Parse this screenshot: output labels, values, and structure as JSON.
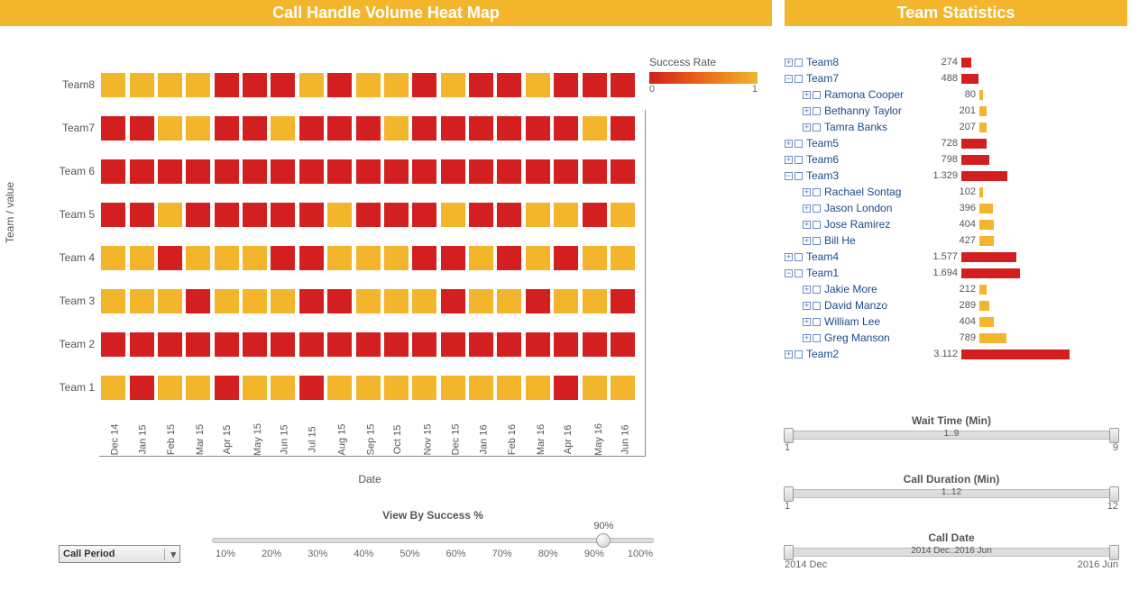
{
  "left": {
    "title": "Call Handle Volume Heat Map",
    "y_axis": "Team / value",
    "x_axis": "Date",
    "legend_title": "Success Rate",
    "legend_min": "0",
    "legend_max": "1",
    "dropdown": "Call Period",
    "view_by_title": "View By Success %",
    "view_by_value": "90%",
    "view_by_ticks": [
      "10%",
      "20%",
      "30%",
      "40%",
      "50%",
      "60%",
      "70%",
      "80%",
      "90%",
      "100%"
    ]
  },
  "right": {
    "title": "Team Statistics",
    "sliders": [
      {
        "title": "Wait Time (Min)",
        "range": "1..9",
        "min": "1",
        "max": "9"
      },
      {
        "title": "Call Duration (Min)",
        "range": "1..12",
        "min": "1",
        "max": "12"
      },
      {
        "title": "Call Date",
        "range": "2014 Dec..2016 Jun",
        "min": "2014 Dec",
        "max": "2016 Jun"
      }
    ]
  },
  "chart_data": {
    "heatmap": {
      "type": "heatmap",
      "title": "Call Handle Volume Heat Map",
      "xlabel": "Date",
      "ylabel": "Team / value",
      "legend": "Success Rate",
      "color_scale_min": 0,
      "color_scale_max": 1,
      "y_categories": [
        "Team8",
        "Team7",
        "Team 6",
        "Team 5",
        "Team 4",
        "Team 3",
        "Team 2",
        "Team 1"
      ],
      "x_categories": [
        "Dec 14",
        "Jan 15",
        "Feb 15",
        "Mar 15",
        "Apr 15",
        "May 15",
        "Jun 15",
        "Jul 15",
        "Aug 15",
        "Sep 15",
        "Oct 15",
        "Nov 15",
        "Dec 15",
        "Jan 16",
        "Feb 16",
        "Mar 16",
        "Apr 16",
        "May 16",
        "Jun 16"
      ],
      "values": [
        [
          1,
          1,
          1,
          1,
          0,
          0,
          0,
          1,
          0,
          1,
          1,
          0,
          1,
          0,
          0,
          1,
          0,
          0,
          0
        ],
        [
          0,
          0,
          1,
          1,
          0,
          0,
          1,
          0,
          0,
          0,
          1,
          0,
          0,
          0,
          0,
          0,
          0,
          1,
          0
        ],
        [
          0,
          0,
          0,
          0,
          0,
          0,
          0,
          0,
          0,
          0,
          0,
          0,
          0,
          0,
          0,
          0,
          0,
          0,
          0
        ],
        [
          0,
          0,
          1,
          0,
          0,
          0,
          0,
          0,
          1,
          0,
          0,
          0,
          1,
          0,
          0,
          1,
          1,
          0,
          1
        ],
        [
          1,
          1,
          0,
          1,
          1,
          1,
          0,
          0,
          1,
          1,
          1,
          0,
          0,
          1,
          0,
          1,
          0,
          1,
          1
        ],
        [
          1,
          1,
          1,
          0,
          1,
          1,
          1,
          0,
          0,
          1,
          1,
          1,
          0,
          1,
          1,
          0,
          1,
          1,
          0
        ],
        [
          0,
          0,
          0,
          0,
          0,
          0,
          0,
          0,
          0,
          0,
          0,
          0,
          0,
          0,
          0,
          0,
          0,
          0,
          0
        ],
        [
          1,
          0,
          1,
          1,
          0,
          1,
          1,
          0,
          1,
          1,
          1,
          1,
          1,
          1,
          1,
          1,
          0,
          1,
          1
        ]
      ],
      "note": "1 = amber cell (higher success rate), 0 = red cell (lower success rate); values estimated from color"
    },
    "team_stats": {
      "type": "bar",
      "title": "Team Statistics",
      "max_value": 3112,
      "rows": [
        {
          "label": "Team8",
          "value": 274,
          "level": 0,
          "kind": "team",
          "state": "plus"
        },
        {
          "label": "Team7",
          "value": 488,
          "level": 0,
          "kind": "team",
          "state": "minus"
        },
        {
          "label": "Ramona Cooper",
          "value": 80,
          "level": 1,
          "kind": "person",
          "state": "plus"
        },
        {
          "label": "Bethanny Taylor",
          "value": 201,
          "level": 1,
          "kind": "person",
          "state": "plus"
        },
        {
          "label": "Tamra Banks",
          "value": 207,
          "level": 1,
          "kind": "person",
          "state": "plus"
        },
        {
          "label": "Team5",
          "value": 728,
          "level": 0,
          "kind": "team",
          "state": "plus"
        },
        {
          "label": "Team6",
          "value": 798,
          "level": 0,
          "kind": "team",
          "state": "plus"
        },
        {
          "label": "Team3",
          "value": 1329,
          "level": 0,
          "kind": "team",
          "state": "minus"
        },
        {
          "label": "Rachael Sontag",
          "value": 102,
          "level": 1,
          "kind": "person",
          "state": "plus"
        },
        {
          "label": "Jason London",
          "value": 396,
          "level": 1,
          "kind": "person",
          "state": "plus"
        },
        {
          "label": "Jose Ramirez",
          "value": 404,
          "level": 1,
          "kind": "person",
          "state": "plus"
        },
        {
          "label": "Bill He",
          "value": 427,
          "level": 1,
          "kind": "person",
          "state": "plus"
        },
        {
          "label": "Team4",
          "value": 1577,
          "level": 0,
          "kind": "team",
          "state": "plus"
        },
        {
          "label": "Team1",
          "value": 1694,
          "level": 0,
          "kind": "team",
          "state": "minus"
        },
        {
          "label": "Jakie More",
          "value": 212,
          "level": 1,
          "kind": "person",
          "state": "plus"
        },
        {
          "label": "David Manzo",
          "value": 289,
          "level": 1,
          "kind": "person",
          "state": "plus"
        },
        {
          "label": "William Lee",
          "value": 404,
          "level": 1,
          "kind": "person",
          "state": "plus"
        },
        {
          "label": "Greg Manson",
          "value": 789,
          "level": 1,
          "kind": "person",
          "state": "plus"
        },
        {
          "label": "Team2",
          "value": 3112,
          "level": 0,
          "kind": "team",
          "state": "plus"
        }
      ]
    }
  }
}
